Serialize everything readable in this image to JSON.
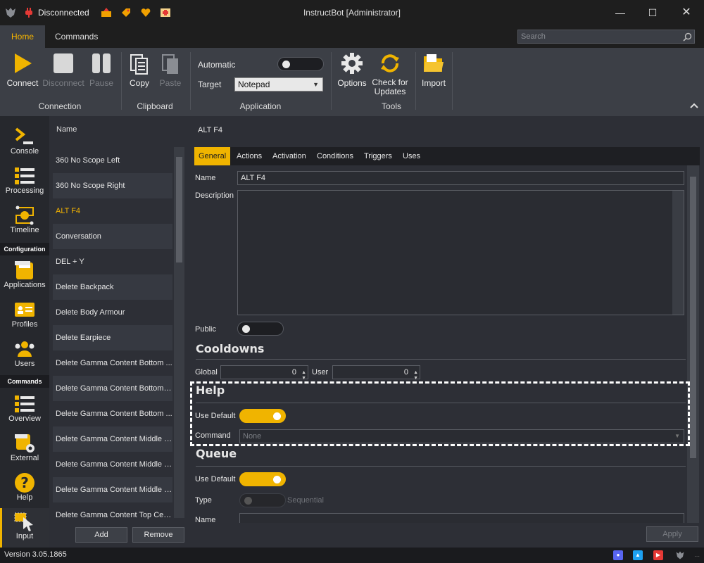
{
  "window": {
    "title": "InstructBot [Administrator]",
    "status": "Disconnected"
  },
  "tabs": [
    {
      "label": "Home",
      "active": true
    },
    {
      "label": "Commands",
      "active": false
    }
  ],
  "search": {
    "placeholder": "Search"
  },
  "ribbon": {
    "connection": {
      "label": "Connection",
      "connect": "Connect",
      "disconnect": "Disconnect",
      "pause": "Pause"
    },
    "clipboard": {
      "label": "Clipboard",
      "copy": "Copy",
      "paste": "Paste"
    },
    "application": {
      "label": "Application",
      "automatic": "Automatic",
      "target": "Target",
      "target_value": "Notepad"
    },
    "tools": {
      "label": "Tools",
      "options": "Options",
      "check_updates_1": "Check for",
      "check_updates_2": "Updates"
    },
    "import": {
      "label": "Import"
    }
  },
  "nav": {
    "items": [
      {
        "label": "Console"
      },
      {
        "label": "Processing"
      },
      {
        "label": "Timeline"
      },
      {
        "label": "Applications"
      },
      {
        "label": "Profiles"
      },
      {
        "label": "Users"
      },
      {
        "label": "Overview"
      },
      {
        "label": "External"
      },
      {
        "label": "Help"
      },
      {
        "label": "Input"
      }
    ],
    "headers": {
      "configuration": "Configuration",
      "commands": "Commands"
    }
  },
  "list": {
    "header": "Name",
    "items": [
      "360 No Scope Left",
      "360 No Scope Right",
      "ALT F4",
      "Conversation",
      "DEL + Y",
      "Delete Backpack",
      "Delete Body Armour",
      "Delete Earpiece",
      "Delete Gamma Content Bottom ...",
      "Delete Gamma Content Bottom L...",
      "Delete Gamma Content Bottom ...",
      "Delete Gamma Content Middle C...",
      "Delete Gamma Content Middle L...",
      "Delete Gamma Content Middle Ri...",
      "Delete Gamma Content Top Cen..."
    ],
    "selected": "ALT F4",
    "add": "Add",
    "remove": "Remove"
  },
  "detail": {
    "title": "ALT F4",
    "tabs": [
      "General",
      "Actions",
      "Activation",
      "Conditions",
      "Triggers",
      "Uses"
    ],
    "name_label": "Name",
    "name_value": "ALT F4",
    "description_label": "Description",
    "public_label": "Public",
    "cooldowns": {
      "title": "Cooldowns",
      "global_label": "Global",
      "global_value": "0",
      "user_label": "User",
      "user_value": "0"
    },
    "help": {
      "title": "Help",
      "use_default_label": "Use Default",
      "command_label": "Command",
      "command_value": "None"
    },
    "queue": {
      "title": "Queue",
      "use_default_label": "Use Default",
      "type_label": "Type",
      "type_value": "Sequential",
      "name_label": "Name"
    },
    "apply": "Apply"
  },
  "statusbar": {
    "version": "Version 3.05.1865"
  },
  "colors": {
    "accent": "#f0b400",
    "bg": "#2d2f36",
    "titlebar": "#1e1e1e"
  }
}
